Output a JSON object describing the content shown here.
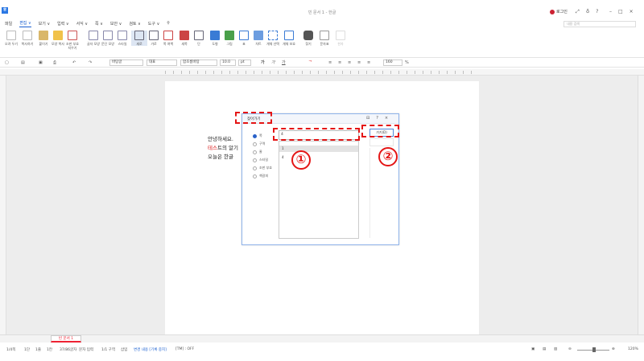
{
  "app": {
    "logo_text": "ㅎ",
    "doc_title": "빈 문서 1 - 한글",
    "login_label": "로그인",
    "title_icons": [
      "⤢",
      "♁",
      "?"
    ],
    "window_buttons": [
      "–",
      "□",
      "×"
    ]
  },
  "menu": {
    "items": [
      "파일",
      "편집 ∨",
      "보기 ∨",
      "입력 ∨",
      "서식 ∨",
      "쪽 ∨",
      "보안 ∨",
      "검토 ∨",
      "도구 ∨",
      "⚲"
    ],
    "active_index": 1
  },
  "ribbon": {
    "buttons": [
      {
        "label": "오려 두기",
        "icon": "scissors-icon"
      },
      {
        "label": "복사하기",
        "icon": "copy-icon"
      },
      {
        "label": "붙이기",
        "icon": "paste-icon"
      },
      {
        "label": "모양 복사",
        "icon": "format-painter-icon"
      },
      {
        "label": "조판 부호 지우기",
        "icon": "clear-format-icon"
      },
      {
        "label": "글자 모양",
        "icon": "char-shape-icon"
      },
      {
        "label": "문단 모양",
        "icon": "para-shape-icon"
      },
      {
        "label": "스타일",
        "icon": "style-icon"
      },
      {
        "label": "세로",
        "icon": "portrait-icon"
      },
      {
        "label": "가로",
        "icon": "landscape-icon"
      },
      {
        "label": "쪽 여백",
        "icon": "margin-icon"
      },
      {
        "label": "새쪽",
        "icon": "new-page-icon"
      },
      {
        "label": "단",
        "icon": "column-icon"
      },
      {
        "label": "도형",
        "icon": "shape-icon"
      },
      {
        "label": "그림",
        "icon": "picture-icon"
      },
      {
        "label": "표",
        "icon": "table-icon"
      },
      {
        "label": "차트",
        "icon": "chart-icon"
      },
      {
        "label": "개체 선택",
        "icon": "select-object-icon"
      },
      {
        "label": "개체 보호",
        "icon": "protect-object-icon"
      },
      {
        "label": "찾기",
        "icon": "find-icon"
      },
      {
        "label": "문자표",
        "icon": "symbol-icon"
      },
      {
        "label": "한자",
        "icon": "hanja-icon"
      }
    ]
  },
  "toolbar": {
    "style": "바탕글",
    "font_lang": "대표",
    "font": "함초롬바탕",
    "font_size": "10.0",
    "unit": "pt",
    "bold": "가",
    "italic": "가",
    "underline": "가",
    "zoom": "160",
    "zoom_unit": "%",
    "search_placeholder": "내용 검색"
  },
  "document": {
    "lines": [
      {
        "before": "안녕하세요.",
        "red": "",
        "after": ""
      },
      {
        "before": "",
        "red": "테스",
        "after": "트의 알기"
      },
      {
        "before": "오늘은 한글",
        "red": "",
        "after": ""
      }
    ]
  },
  "dialog": {
    "title": "찾아가기",
    "icons": [
      "⊟",
      "?",
      "×"
    ],
    "options": [
      {
        "label": "쪽",
        "selected": true
      },
      {
        "label": "구역",
        "selected": false
      },
      {
        "label": "줄",
        "selected": false
      },
      {
        "label": "스타일",
        "selected": false
      },
      {
        "label": "조판 부호",
        "selected": false
      },
      {
        "label": "책갈피",
        "selected": false
      }
    ],
    "input_value": "4",
    "list_items": [
      "1",
      "4"
    ],
    "button_label": "가기(D)"
  },
  "annotations": {
    "marker1": "①",
    "marker2": "②",
    "color": "#e41515"
  },
  "tabs": {
    "sheet": "빈 문서 1"
  },
  "status": {
    "page": "1/4쪽",
    "column": "1단",
    "line": "1줄",
    "col": "1칸",
    "chars": "37/86글자",
    "lang": "문자 입력",
    "section": "1/1 구역",
    "mode": "삽입",
    "track": "변경 내용 [기록 중지]",
    "caps": "[TM] : OFF",
    "zoom": "120%"
  }
}
